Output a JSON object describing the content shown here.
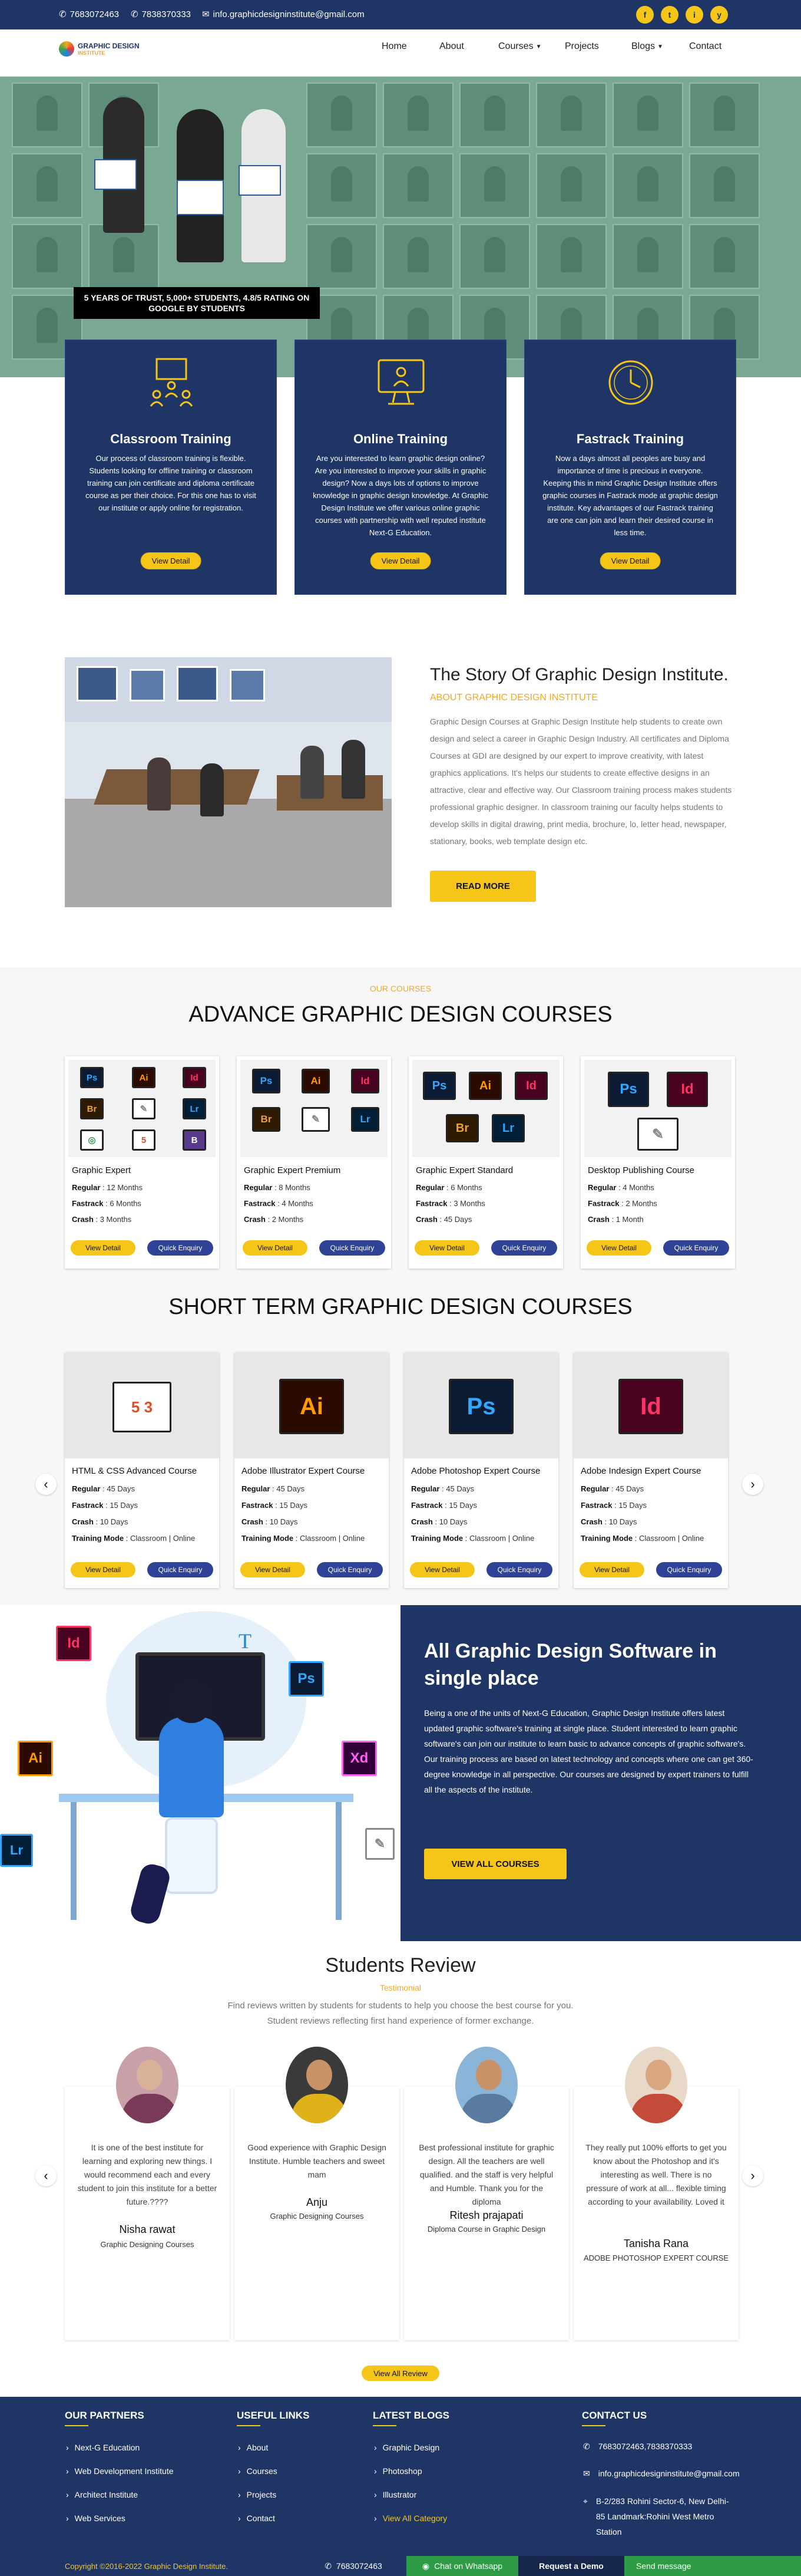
{
  "topbar": {
    "phone1": "7683072463",
    "phone2": "7838370333",
    "email": "info.graphicdesigninstitute@gmail.com",
    "social": [
      "f",
      "t",
      "i",
      "y"
    ]
  },
  "brand": {
    "name": "GRAPHIC DESIGN",
    "sub": "INSTITUTE"
  },
  "nav": {
    "home": "Home",
    "about": "About",
    "courses": "Courses",
    "projects": "Projects",
    "blogs": "Blogs",
    "contact": "Contact"
  },
  "hero": {
    "caption": "5 YEARS OF TRUST, 5,000+ STUDENTS, 4.8/5 RATING ON GOOGLE BY STUDENTS"
  },
  "training": [
    {
      "title": "Classroom Training",
      "text": "Our process of classroom training is flexible. Students looking for offline training or classroom training can join certificate and diploma certificate course as per their choice. For this one has to visit our institute or apply online for registration.",
      "btn": "View Detail",
      "icon": "classroom-icon"
    },
    {
      "title": "Online Training",
      "text": "Are you interested to learn graphic design online?Are you interested to improve your skills in graphic design? Now a days lots of options to improve knowledge in graphic design knowledge. At Graphic Design Institute we offer various online graphic courses with partnership with well reputed institute Next-G Education.",
      "btn": "View Detail",
      "icon": "monitor-icon"
    },
    {
      "title": "Fastrack Training",
      "text": "Now a days almost all peoples are busy and importance of time is precious in everyone. Keeping this in mind Graphic Design Institute offers graphic courses in Fastrack mode at graphic design institute. Key advantages of our Fastrack training are one can join and learn their desired course in less time.",
      "btn": "View Detail",
      "icon": "clock-icon"
    }
  ],
  "story": {
    "title": "The Story Of Graphic Design Institute.",
    "subtitle": "ABOUT GRAPHIC DESIGN INSTITUTE",
    "text": "Graphic Design Courses at Graphic Design Institute help students to create own design and select a career in Graphic Design Industry. All certificates and Diploma Courses at GDI are designed by our expert to improve creativity, with latest graphics applications. It's helps our students to create effective designs in an attractive, clear and effective way. Our Classroom training process makes students professional graphic designer. In classroom training our faculty helps students to develop skills in digital drawing, print media, brochure, lo, letter head, newspaper, stationary, books, web template design etc.",
    "btn": "READ MORE"
  },
  "advance": {
    "small": "OUR COURSES",
    "title": "ADVANCE GRAPHIC DESIGN COURSES",
    "cards": [
      {
        "title": "Graphic Expert",
        "regular": "12 Months",
        "fastrack": "6 Months",
        "crash": "3 Months"
      },
      {
        "title": "Graphic Expert Premium",
        "regular": "8 Months",
        "fastrack": "4 Months",
        "crash": "2 Months"
      },
      {
        "title": "Graphic Expert Standard",
        "regular": "6 Months",
        "fastrack": "3 Months",
        "crash": "45 Days"
      },
      {
        "title": "Desktop Publishing Course",
        "regular": "4 Months",
        "fastrack": "2 Months",
        "crash": "1 Month"
      }
    ],
    "labels": {
      "regular": "Regular",
      "fastrack": "Fastrack",
      "crash": "Crash",
      "btn1": "View Detail",
      "btn2": "Quick Enquiry"
    }
  },
  "shortterm": {
    "title": "SHORT TERM GRAPHIC DESIGN COURSES",
    "cards": [
      {
        "title": "HTML & CSS Advanced Course",
        "regular": "45 Days",
        "fastrack": "15 Days",
        "crash": "10 Days",
        "mode": "Classroom | Online"
      },
      {
        "title": "Adobe Illustrator Expert Course",
        "regular": "45 Days",
        "fastrack": "15 Days",
        "crash": "10 Days",
        "mode": "Classroom | Online"
      },
      {
        "title": "Adobe Photoshop Expert Course",
        "regular": "45 Days",
        "fastrack": "15 Days",
        "crash": "10 Days",
        "mode": "Classroom | Online"
      },
      {
        "title": "Adobe Indesign Expert Course",
        "regular": "45 Days",
        "fastrack": "15 Days",
        "crash": "10 Days",
        "mode": "Classroom | Online"
      }
    ],
    "labels": {
      "mode": "Training Mode"
    }
  },
  "software": {
    "title": "All Graphic Design Software in single place",
    "text": "Being a one of the units of Next-G Education, Graphic Design Institute offers latest updated graphic software's training at single place. Student interested to learn graphic software's can join our institute to learn basic to advance concepts of graphic software's. Our training process are based on latest technology and concepts where one can get 360-degree knowledge in all perspective. Our courses are designed by expert trainers to fulfill all the aspects of the institute.",
    "btn": "VIEW ALL COURSES"
  },
  "reviews": {
    "title": "Students Review",
    "sub": "Testimonial",
    "desc1": "Find reviews written by students for students to help you choose the best course for you.",
    "desc2": "Student reviews reflecting first hand experience of former exchange.",
    "items": [
      {
        "text": "It is one of the best institute for learning and exploring new things. I would recommend each and every student to join this institute for a better future.????",
        "name": "Nisha rawat",
        "course": "Graphic Designing Courses"
      },
      {
        "text": "Good experience with Graphic Design Institute. Humble teachers and sweet mam",
        "name": "Anju",
        "course": "Graphic Designing Courses"
      },
      {
        "text": "Best professional institute for graphic design. All the teachers are well qualified. and the staff is very helpful and Humble. Thank you for the diploma",
        "name": "Ritesh prajapati",
        "course": "Diploma Course in Graphic Design"
      },
      {
        "text": "They really put 100% efforts to get you know about the Photoshop and it's interesting as well. There is no pressure of work at all... flexible timing according to your availability. Loved it",
        "name": "Tanisha Rana",
        "course": "ADOBE PHOTOSHOP EXPERT COURSE"
      }
    ],
    "btn": "View All Review"
  },
  "footer": {
    "partners_title": "OUR PARTNERS",
    "partners": [
      "Next-G Education",
      "Web Development Institute",
      "Architect Institute",
      "Web Services"
    ],
    "links_title": "USEFUL LINKS",
    "links": [
      "About",
      "Courses",
      "Projects",
      "Contact"
    ],
    "blogs_title": "LATEST BLOGS",
    "blogs": [
      "Graphic Design",
      "Photoshop",
      "Illustrator",
      "View All Category"
    ],
    "contact_title": "CONTACT US",
    "contact_phone": "7683072463,7838370333",
    "contact_email": "info.graphicdesigninstitute@gmail.com",
    "contact_address": "B-2/283 Rohini Sector-6, New Delhi-85 Landmark:Rohini West Metro Station"
  },
  "bottom": {
    "copyright": "Copyright ©2016-2022 Graphic Design Institute.",
    "phone": "7683072463",
    "whatsapp": "Chat on Whatsapp",
    "demo": "Request a Demo",
    "message": "Send message"
  },
  "colors": {
    "navy": "#1f3566",
    "yellow": "#f5c518",
    "orange": "#f5a623",
    "blue_btn": "#2f4296"
  }
}
